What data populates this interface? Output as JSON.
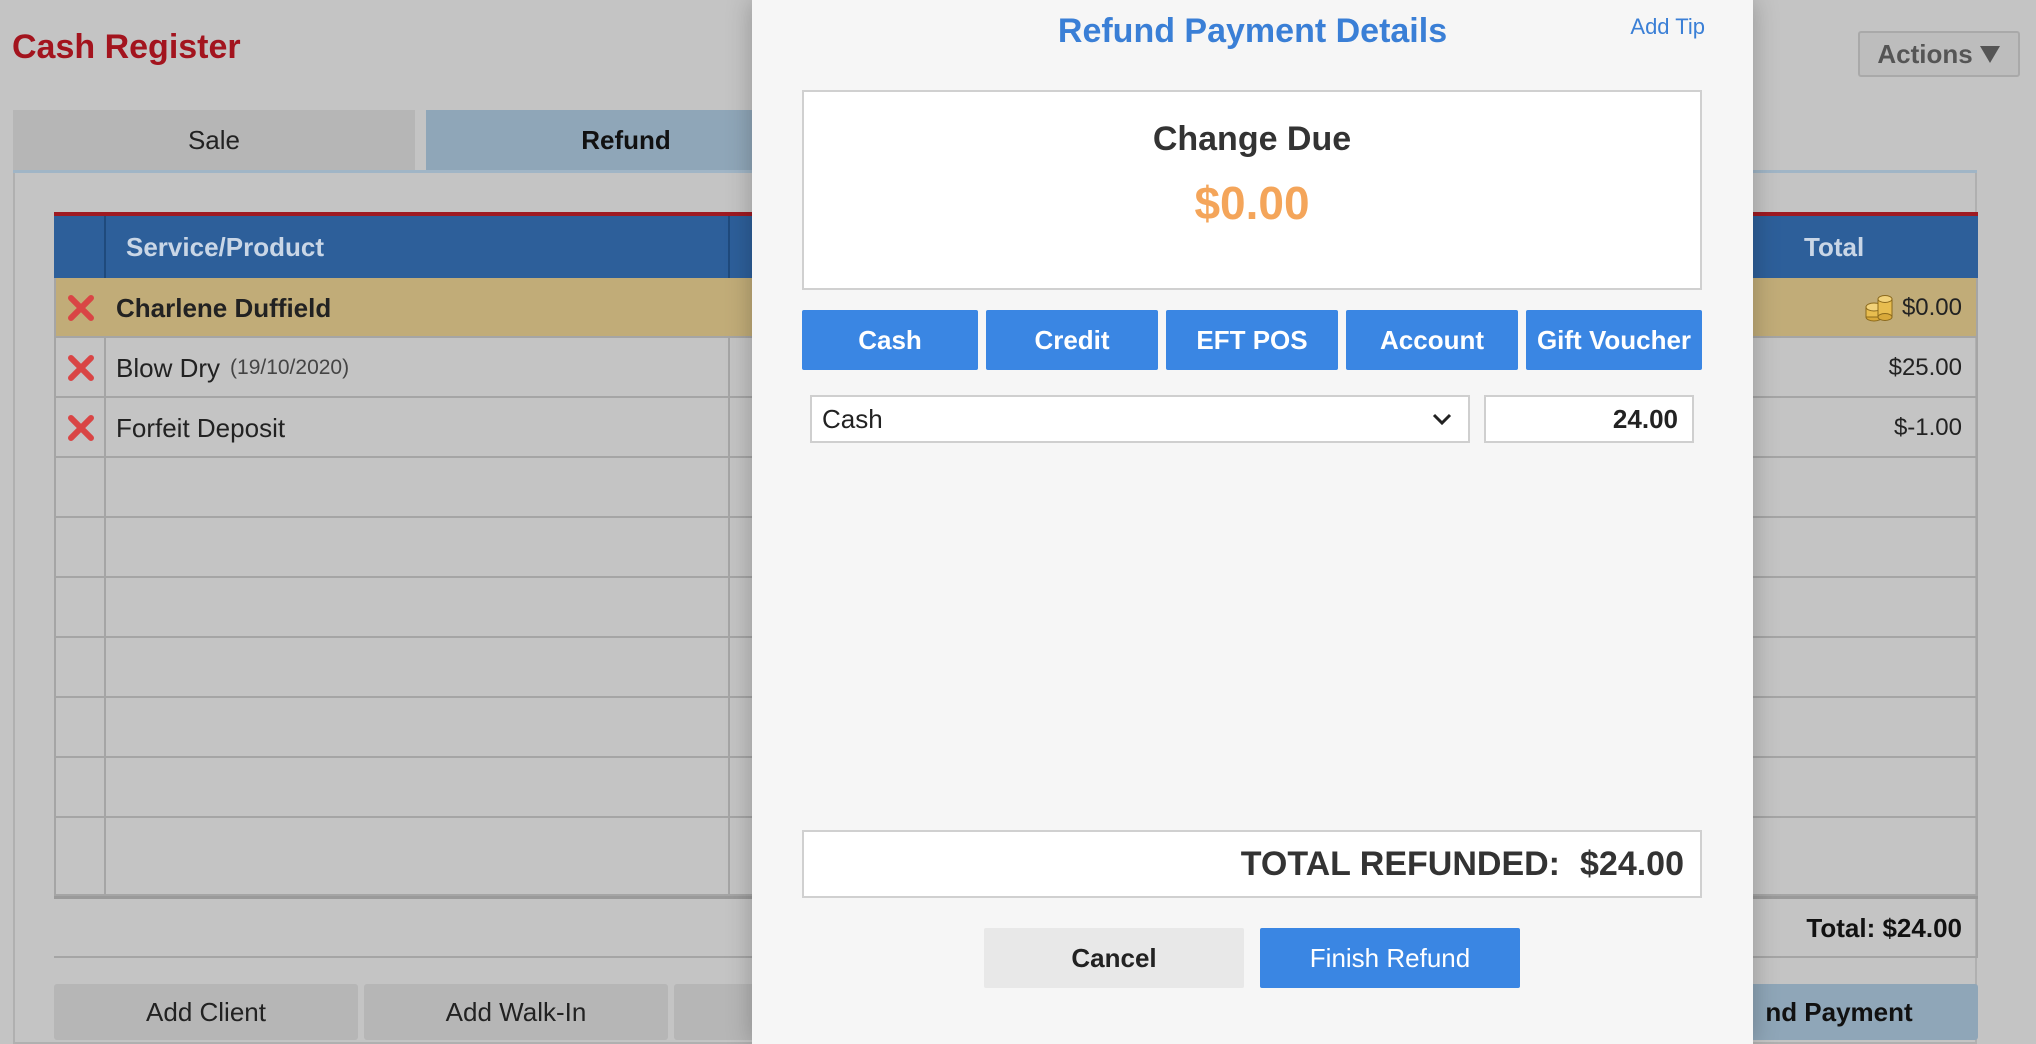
{
  "app": {
    "title": "Cash Register",
    "actions_label": "Actions"
  },
  "tabs": [
    {
      "label": "Sale"
    },
    {
      "label": "Refund"
    }
  ],
  "table": {
    "columns": {
      "service_product": "Service/Product",
      "total": "Total"
    },
    "rows": [
      {
        "name": "Charlene Duffield",
        "sub": "",
        "total": "$0.00",
        "type": "client"
      },
      {
        "name": "Blow Dry",
        "sub": "(19/10/2020)",
        "total": "$25.00",
        "type": "item"
      },
      {
        "name": "Forfeit Deposit",
        "sub": "",
        "total": "$-1.00",
        "type": "item"
      }
    ],
    "footer_total": "Total: $24.00"
  },
  "bottom_buttons": {
    "add_client": "Add Client",
    "add_walkin": "Add Walk-In",
    "refund_payment_partial": "nd Payment"
  },
  "modal": {
    "title": "Refund Payment Details",
    "add_tip": "Add Tip",
    "change_label": "Change Due",
    "change_amount": "$0.00",
    "payment_methods": [
      "Cash",
      "Credit",
      "EFT POS",
      "Account",
      "Gift Voucher"
    ],
    "selected_method": "Cash",
    "amount": "24.00",
    "total_label": "TOTAL REFUNDED:",
    "total_value": "$24.00",
    "cancel_label": "Cancel",
    "finish_label": "Finish Refund"
  },
  "colors": {
    "brand_red": "#a3141e",
    "header_blue": "#2d5f9a",
    "button_blue": "#3a86e3",
    "change_orange": "#f4a55a",
    "client_row": "#c1ac78"
  },
  "icons": {
    "remove": "remove-x-icon",
    "coins": "coins-icon",
    "dropdown": "chevron-down-icon",
    "actions": "triangle-down-icon"
  }
}
